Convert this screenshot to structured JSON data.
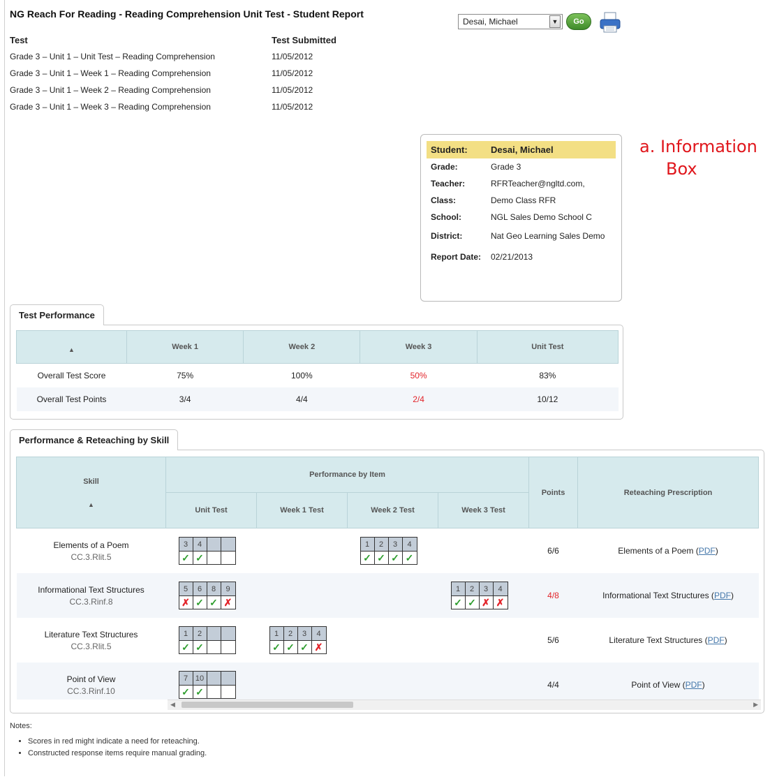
{
  "report": {
    "title": "NG Reach For Reading - Reading Comprehension Unit Test - Student Report",
    "student_select": "Desai, Michael",
    "go_label": "Go"
  },
  "tests": {
    "headers": [
      "Test",
      "Test Submitted"
    ],
    "rows": [
      {
        "name": "Grade 3 – Unit 1 – Unit Test – Reading Comprehension",
        "date": "11/05/2012"
      },
      {
        "name": "Grade 3 – Unit 1 – Week 1 – Reading Comprehension",
        "date": "11/05/2012"
      },
      {
        "name": "Grade 3 – Unit 1 – Week 2 – Reading Comprehension",
        "date": "11/05/2012"
      },
      {
        "name": "Grade 3 – Unit 1 – Week 3 – Reading Comprehension",
        "date": "11/05/2012"
      }
    ]
  },
  "info": {
    "rows": [
      {
        "label": "Student:",
        "value": "Desai, Michael"
      },
      {
        "label": "Grade:",
        "value": "Grade 3"
      },
      {
        "label": "Teacher:",
        "value": "RFRTeacher@ngltd.com,"
      },
      {
        "label": "Class:",
        "value": "Demo Class RFR"
      },
      {
        "label": "School:",
        "value": "NGL Sales Demo School C"
      },
      {
        "label": "District:",
        "value": "Nat Geo Learning Sales Demo"
      },
      {
        "label": "Report Date:",
        "value": "02/21/2013"
      }
    ],
    "annotation_line1": "a. Information",
    "annotation_line2": "Box"
  },
  "performance": {
    "tab": "Test Performance",
    "sort_icon": "▲",
    "columns": [
      "Week 1",
      "Week 2",
      "Week 3",
      "Unit Test"
    ],
    "rows": [
      {
        "label": "Overall Test Score",
        "values": [
          "75%",
          "100%",
          "50%",
          "83%"
        ]
      },
      {
        "label": "Overall Test Points",
        "values": [
          "3/4",
          "4/4",
          "2/4",
          "10/12"
        ]
      }
    ]
  },
  "skills": {
    "tab": "Performance & Reteaching by Skill",
    "sort_icon": "▲",
    "headers": {
      "skill": "Skill",
      "by_item": "Performance by Item",
      "points": "Points",
      "prescription": "Reteaching Prescription",
      "sub": [
        "Unit Test",
        "Week 1 Test",
        "Week 2 Test",
        "Week 3 Test"
      ]
    },
    "pdf_label": "PDF",
    "rows": [
      {
        "name": "Elements of a Poem",
        "code": "CC.3.Rlit.5",
        "points": "6/6",
        "prescription": "Elements of a Poem"
      },
      {
        "name": "Informational Text Structures",
        "code": "CC.3.Rinf.8",
        "points": "4/8",
        "prescription": "Informational Text Structures"
      },
      {
        "name": "Literature Text Structures",
        "code": "CC.3.Rlit.5",
        "points": "5/6",
        "prescription": "Literature Text Structures"
      },
      {
        "name": "Point of View",
        "code": "CC.3.Rinf.10",
        "points": "4/4",
        "prescription": "Point of View"
      }
    ],
    "items": {
      "r0_unit": {
        "nums": [
          "3",
          "4",
          "",
          ""
        ],
        "marks": [
          "✓",
          "✓",
          "",
          ""
        ]
      },
      "r0_w2": {
        "nums": [
          "1",
          "2",
          "3",
          "4"
        ],
        "marks": [
          "✓",
          "✓",
          "✓",
          "✓"
        ]
      },
      "r1_unit": {
        "nums": [
          "5",
          "6",
          "8",
          "9"
        ],
        "marks": [
          "✗",
          "✓",
          "✓",
          "✗"
        ]
      },
      "r1_w3": {
        "nums": [
          "1",
          "2",
          "3",
          "4"
        ],
        "marks": [
          "✓",
          "✓",
          "✗",
          "✗"
        ]
      },
      "r2_unit": {
        "nums": [
          "1",
          "2",
          "",
          ""
        ],
        "marks": [
          "✓",
          "✓",
          "",
          ""
        ]
      },
      "r2_w1": {
        "nums": [
          "1",
          "2",
          "3",
          "4"
        ],
        "marks": [
          "✓",
          "✓",
          "✓",
          "✗"
        ]
      },
      "r3_unit": {
        "nums": [
          "7",
          "10",
          "",
          ""
        ],
        "marks": [
          "✓",
          "✓",
          "",
          ""
        ]
      }
    }
  },
  "notes": {
    "title": "Notes:",
    "items": [
      "Scores in red might indicate a need for reteaching.",
      "Constructed response items require manual grading."
    ]
  },
  "colors": {
    "accent_red": "#e2242a",
    "highlight": "#f3df84",
    "header_bg": "#d6eaed",
    "go_green": "#4f9a38"
  }
}
